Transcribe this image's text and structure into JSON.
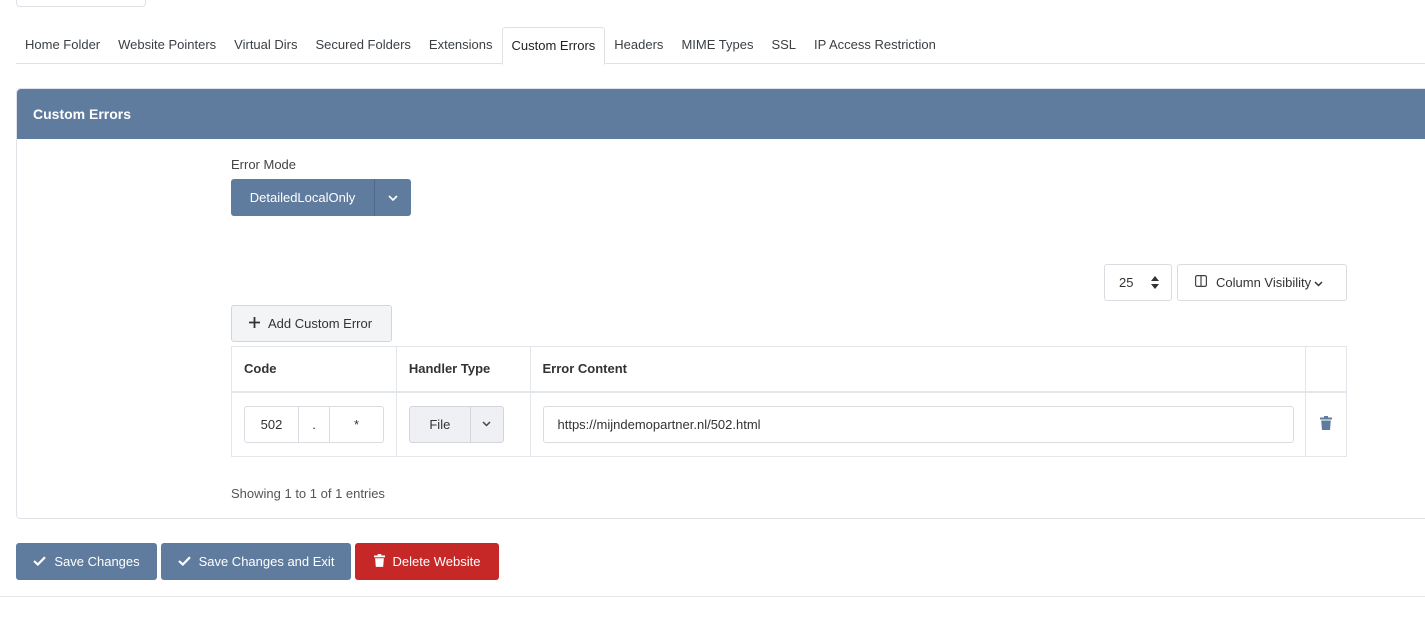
{
  "tabs": [
    {
      "label": "Home Folder"
    },
    {
      "label": "Website Pointers"
    },
    {
      "label": "Virtual Dirs"
    },
    {
      "label": "Secured Folders"
    },
    {
      "label": "Extensions"
    },
    {
      "label": "Custom Errors",
      "active": true
    },
    {
      "label": "Headers"
    },
    {
      "label": "MIME Types"
    },
    {
      "label": "SSL"
    },
    {
      "label": "IP Access Restriction"
    }
  ],
  "panel": {
    "title": "Custom Errors",
    "error_mode_label": "Error Mode",
    "error_mode_value": "DetailedLocalOnly"
  },
  "table_controls": {
    "page_length": "25",
    "column_visibility_label": "Column Visibility",
    "add_button_label": "Add Custom Error"
  },
  "table": {
    "headers": [
      "Code",
      "Handler Type",
      "Error Content"
    ],
    "rows": [
      {
        "code": "502",
        "separator": ".",
        "subcode": "*",
        "handler": "File",
        "content": "https://mijndemopartner.nl/502.html"
      }
    ],
    "info": "Showing 1 to 1 of 1 entries"
  },
  "actions": {
    "save": "Save Changes",
    "save_exit": "Save Changes and Exit",
    "delete": "Delete Website"
  },
  "colors": {
    "accent": "#5f7c9e",
    "danger": "#c62828"
  }
}
